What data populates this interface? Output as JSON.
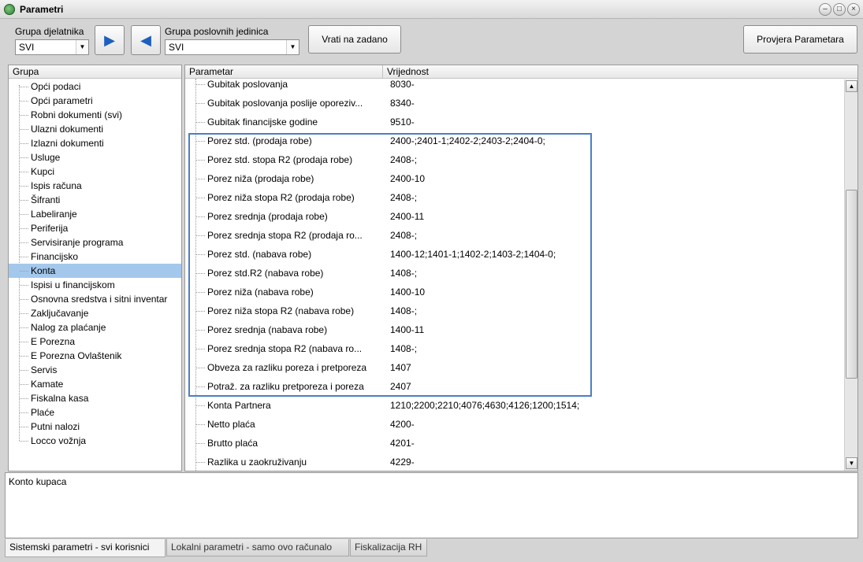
{
  "window": {
    "title": "Parametri",
    "controls": [
      "minimize-icon",
      "maximize-icon",
      "close-icon"
    ]
  },
  "toolbar": {
    "group_label": "Grupa djelatnika",
    "group_value": "SVI",
    "next_icon": "arrow-right-icon",
    "prev_icon": "arrow-left-icon",
    "unit_label": "Grupa poslovnih jedinica",
    "unit_value": "SVI",
    "reset_label": "Vrati na zadano",
    "check_label": "Provjera Parametara"
  },
  "groups": {
    "header": "Grupa",
    "items": [
      "Opći podaci",
      "Opći parametri",
      "Robni dokumenti (svi)",
      "Ulazni dokumenti",
      "Izlazni dokumenti",
      "Usluge",
      "Kupci",
      "Ispis računa",
      "Šifranti",
      "Labeliranje",
      "Periferija",
      "Servisiranje programa",
      "Financijsko",
      "Konta",
      "Ispisi u financijskom",
      "Osnovna sredstva i sitni inventar",
      "Zaključavanje",
      "Nalog za plaćanje",
      "E Porezna",
      "E Porezna Ovlaštenik",
      "Servis",
      "Kamate",
      "Fiskalna kasa",
      "Plaće",
      "Putni nalozi",
      "Locco vožnja"
    ],
    "selected": "Konta"
  },
  "params": {
    "col_param": "Parametar",
    "col_value": "Vrijednost",
    "rows": [
      {
        "name": "Gubitak poslovanja",
        "value": "8030-"
      },
      {
        "name": "Gubitak poslovanja poslije oporeziv...",
        "value": "8340-"
      },
      {
        "name": "Gubitak financijske godine",
        "value": "9510-"
      },
      {
        "name": "Porez std. (prodaja robe)",
        "value": "2400-;2401-1;2402-2;2403-2;2404-0;"
      },
      {
        "name": "Porez std. stopa R2 (prodaja  robe)",
        "value": "2408-;"
      },
      {
        "name": "Porez niža (prodaja robe)",
        "value": "2400-10"
      },
      {
        "name": "Porez niža stopa R2 (prodaja  robe)",
        "value": "2408-;"
      },
      {
        "name": "Porez srednja (prodaja robe)",
        "value": "2400-11"
      },
      {
        "name": "Porez srednja stopa R2 (prodaja  ro...",
        "value": "2408-;"
      },
      {
        "name": "Porez std. (nabava  robe)",
        "value": "1400-12;1401-1;1402-2;1403-2;1404-0;"
      },
      {
        "name": "Porez std.R2 (nabava  robe)",
        "value": "1408-;"
      },
      {
        "name": "Porez niža (nabava  robe)",
        "value": "1400-10"
      },
      {
        "name": "Porez niža stopa R2 (nabava  robe)",
        "value": "1408-;"
      },
      {
        "name": "Porez srednja (nabava  robe)",
        "value": "1400-11"
      },
      {
        "name": "Porez srednja stopa R2 (nabava  ro...",
        "value": "1408-;"
      },
      {
        "name": "Obveza za razliku poreza i pretporeza",
        "value": "1407"
      },
      {
        "name": "Potraž. za razliku pretporeza i poreza",
        "value": "2407"
      },
      {
        "name": "Konta Partnera",
        "value": "1210;2200;2210;4076;4630;4126;1200;1514;"
      },
      {
        "name": "Netto plaća",
        "value": "4200-"
      },
      {
        "name": "Brutto plaća",
        "value": "4201-"
      },
      {
        "name": "Razlika u zaokruživanju",
        "value": "4229-"
      }
    ]
  },
  "description": "Konto kupaca",
  "tabs": [
    "Sistemski parametri - svi korisnici",
    "Lokalni parametri - samo ovo računalo",
    "Fiskalizacija RH"
  ],
  "colors": {
    "selection": "#a3c8ec",
    "highlight_border": "#4a7fc4",
    "nav_arrow": "#1d5fbf"
  }
}
